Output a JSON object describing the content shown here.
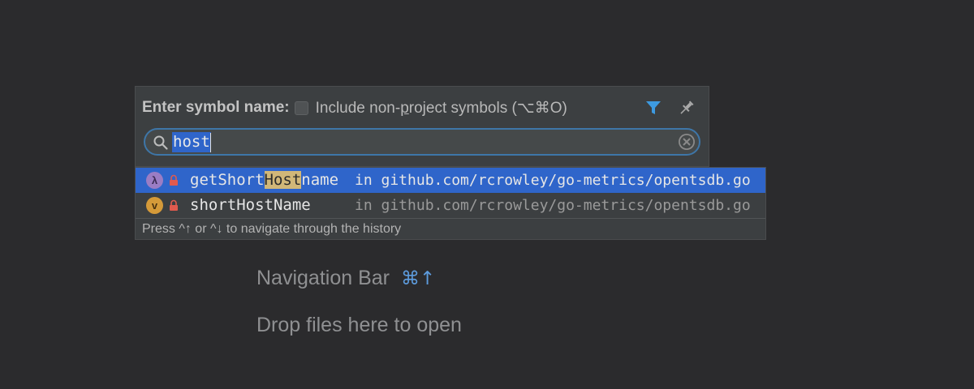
{
  "background": {
    "navigation_bar_label": "Navigation Bar",
    "navigation_bar_shortcut": "⌘↑",
    "drop_files_label": "Drop files here to open"
  },
  "popup": {
    "title": "Enter symbol name:",
    "include_label_pre": "Include non-",
    "include_label_mnemonic": "p",
    "include_label_post": "roject symbols (⌥⌘O)",
    "include_checked": false,
    "filter_icon": "filter-icon",
    "pin_icon": "pin-icon",
    "search": {
      "value": "host",
      "icon": "search-icon",
      "clear_icon": "clear-icon"
    }
  },
  "results": {
    "items": [
      {
        "kind": "function",
        "badge": "λ",
        "name_pre": "getShort",
        "name_match": "Host",
        "name_post": "name",
        "location": "in github.com/rcrowley/go-metrics/opentsdb.go",
        "selected": true
      },
      {
        "kind": "variable",
        "badge": "v",
        "name_pre": "shortHostName",
        "name_match": "",
        "name_post": "",
        "location": "in github.com/rcrowley/go-metrics/opentsdb.go",
        "selected": false
      }
    ],
    "footer": "Press ^↑ or ^↓ to navigate through the history"
  },
  "colors": {
    "selection": "#2f65ca",
    "match_highlight": "#d1b778",
    "accent": "#5d9bdc"
  }
}
